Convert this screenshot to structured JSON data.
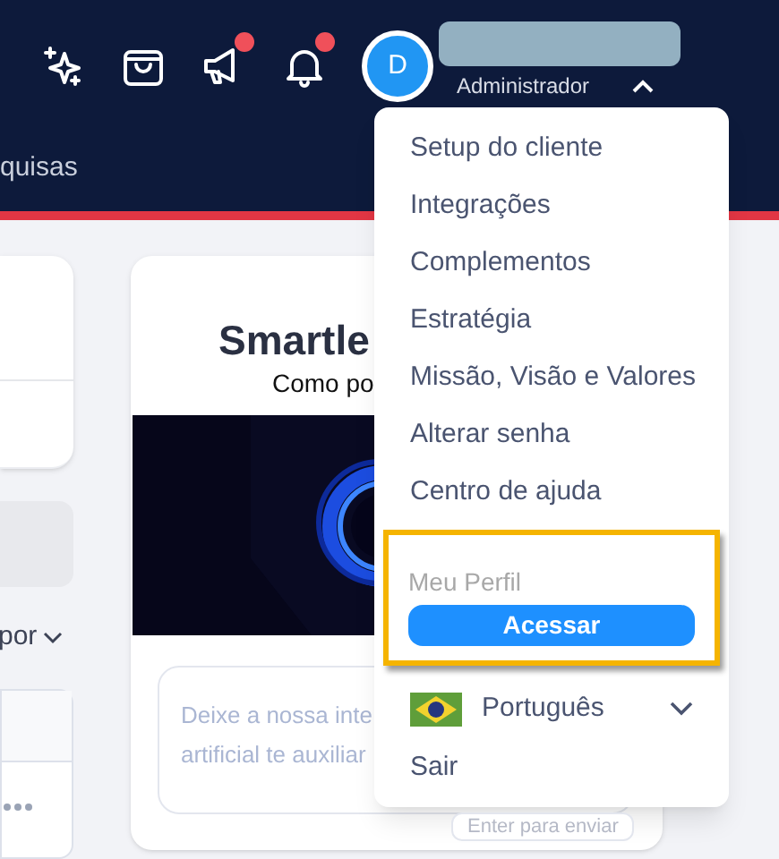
{
  "header": {
    "icons": [
      {
        "kind": "sparkles",
        "badge": false
      },
      {
        "kind": "bag",
        "badge": false
      },
      {
        "kind": "megaphone",
        "badge": true
      },
      {
        "kind": "bell",
        "badge": true
      }
    ],
    "avatar": "D",
    "user_role": "Administrador",
    "menu_expanded": true,
    "nav_tab": "quisas"
  },
  "left_panel": {
    "filter_label": "por"
  },
  "card": {
    "title": "Smartle",
    "subtitle": "Como po",
    "placeholder_lines": [
      "Deixe a nossa inte",
      "artificial te auxiliar"
    ],
    "hint": "Enter para enviar"
  },
  "menu": {
    "items": [
      "Setup do cliente",
      "Integrações",
      "Complementos",
      "Estratégia",
      "Missão, Visão e Valores",
      "Alterar senha",
      "Centro de ajuda"
    ],
    "profile": {
      "label": "Meu Perfil",
      "button": "Acessar"
    },
    "language": "Português",
    "logout": "Sair"
  }
}
